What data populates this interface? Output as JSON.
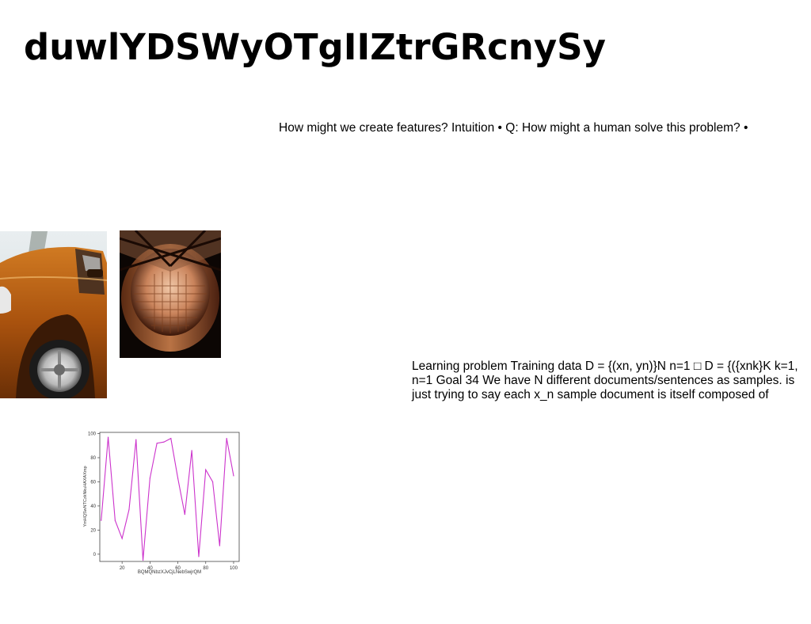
{
  "slide": {
    "title": "duwlYDSWyOTgIIZtrGRcnySy",
    "paragraph_intuition": "How might we create features? Intuition • Q: How might a human solve this problem? •",
    "paragraph_learning": "Learning problem Training data D = {(xn, yn)}N n=1 □ D = {({xnk}K k=1, n=1 Goal 34 We have N different documents/sentences as samples. is just trying to say each x_n sample document is itself composed of",
    "images": [
      {
        "name": "orange-car-photo"
      },
      {
        "name": "architecture-ceiling-photo"
      }
    ]
  },
  "chart_data": {
    "type": "line",
    "xlabel": "BQMQNbzXJvCjLNebSwjrQM",
    "ylabel": "YmHQSwNTCzkNkuHAXAXmp",
    "xlim": [
      4,
      104
    ],
    "ylim": [
      -6,
      101
    ],
    "xticks": [
      20,
      40,
      60,
      80,
      100
    ],
    "yticks": [
      0,
      20,
      40,
      60,
      80,
      100
    ],
    "series": [
      {
        "color": "#cc33cc",
        "x": [
          5,
          10,
          15,
          20,
          25,
          30,
          35,
          40,
          45,
          50,
          55,
          60,
          65,
          70,
          75,
          80,
          85,
          90,
          95,
          100
        ],
        "y": [
          28,
          97,
          28,
          13,
          37,
          95,
          -5,
          63,
          92,
          93,
          96,
          63,
          33,
          86,
          -2,
          70,
          60,
          7,
          96,
          65
        ]
      }
    ]
  }
}
